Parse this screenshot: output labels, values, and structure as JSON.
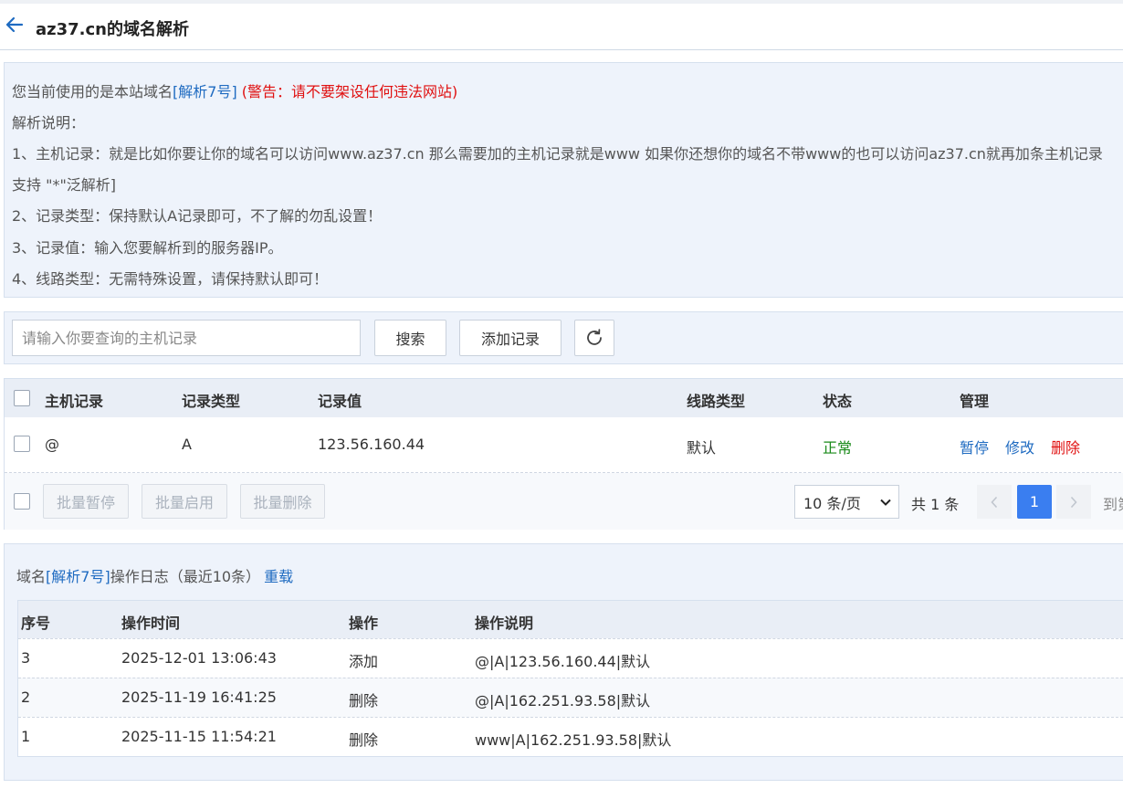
{
  "header": {
    "title": "az37.cn的域名解析"
  },
  "notice": {
    "line1_prefix": "您当前使用的是本站域名",
    "line1_link": "[解析7号]",
    "line1_warning": " (警告：请不要架设任何违法网站)",
    "line2": "解析说明：",
    "line3": "1、主机记录：就是比如你要让你的域名可以访问www.az37.cn 那么需要加的主机记录就是www 如果你还想你的域名不带www的也可以访问az37.cn就再加条主机记录",
    "line4": "支持 \"*\"泛解析]",
    "line5": "2、记录类型：保持默认A记录即可，不了解的勿乱设置！",
    "line6": "3、记录值：输入您要解析到的服务器IP。",
    "line7": "4、线路类型：无需特殊设置，请保持默认即可！"
  },
  "toolbar": {
    "search_placeholder": "请输入你要查询的主机记录",
    "search_label": "搜索",
    "add_label": "添加记录",
    "refresh_icon": "refresh-icon"
  },
  "records": {
    "columns": [
      "主机记录",
      "记录类型",
      "记录值",
      "线路类型",
      "状态",
      "管理"
    ],
    "rows": [
      {
        "host": "@",
        "type": "A",
        "value": "123.56.160.44",
        "line": "默认",
        "status": "正常",
        "actions": [
          "暂停",
          "修改",
          "删除"
        ]
      }
    ],
    "batch": [
      "批量暂停",
      "批量启用",
      "批量删除"
    ],
    "per_page": "10 条/页",
    "total": "共 1 条",
    "current_page": "1",
    "goto": "到第"
  },
  "log": {
    "title_prefix": "域名",
    "title_link": "[解析7号]",
    "title_suffix": "操作日志（最近10条）",
    "reload": "重载",
    "columns": [
      "序号",
      "操作时间",
      "操作",
      "操作说明"
    ],
    "rows": [
      {
        "id": "3",
        "time": "2025-12-01 13:06:43",
        "op": "添加",
        "desc": "@|A|123.56.160.44|默认"
      },
      {
        "id": "2",
        "time": "2025-11-19 16:41:25",
        "op": "删除",
        "desc": "@|A|162.251.93.58|默认"
      },
      {
        "id": "1",
        "time": "2025-11-15 11:54:21",
        "op": "删除",
        "desc": "www|A|162.251.93.58|默认"
      }
    ]
  },
  "colors": {
    "accent": "#1f6bc1",
    "danger": "#e01010",
    "ok": "#1a8a1a",
    "page_active": "#3a7ef0"
  }
}
